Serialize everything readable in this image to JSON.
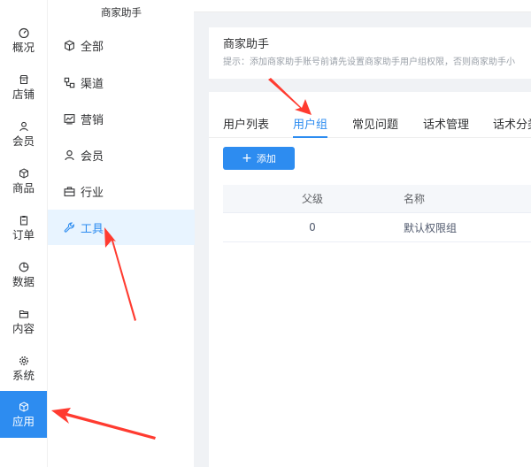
{
  "rail": {
    "items": [
      {
        "label": "概况",
        "icon": "dashboard-icon"
      },
      {
        "label": "店铺",
        "icon": "store-icon"
      },
      {
        "label": "会员",
        "icon": "user-icon"
      },
      {
        "label": "商品",
        "icon": "box-icon"
      },
      {
        "label": "订单",
        "icon": "clipboard-icon"
      },
      {
        "label": "数据",
        "icon": "pie-chart-icon"
      },
      {
        "label": "内容",
        "icon": "folder-icon"
      },
      {
        "label": "系统",
        "icon": "gear-icon"
      },
      {
        "label": "应用",
        "icon": "cube-icon"
      }
    ],
    "active": "应用"
  },
  "submenu": {
    "title": "商家助手",
    "items": [
      {
        "label": "全部",
        "icon": "cube-icon"
      },
      {
        "label": "渠道",
        "icon": "channel-icon"
      },
      {
        "label": "营销",
        "icon": "trend-chart-icon"
      },
      {
        "label": "会员",
        "icon": "user-icon"
      },
      {
        "label": "行业",
        "icon": "briefcase-icon"
      },
      {
        "label": "工具",
        "icon": "wrench-icon"
      }
    ],
    "active": "工具"
  },
  "header": {
    "title": "商家助手",
    "tip": "提示：添加商家助手账号前请先设置商家助手用户组权限，否则商家助手小"
  },
  "tabs": [
    {
      "label": "用户列表"
    },
    {
      "label": "用户组"
    },
    {
      "label": "常见问题"
    },
    {
      "label": "话术管理"
    },
    {
      "label": "话术分类"
    }
  ],
  "active_tab": "用户组",
  "add_button": {
    "label": "添加",
    "icon": "plus-icon"
  },
  "table": {
    "columns": [
      "父级",
      "名称"
    ],
    "rows": [
      [
        "0",
        "默认权限组"
      ]
    ]
  },
  "colors": {
    "primary": "#2d8cf0",
    "annotation_arrow": "#ff3b30"
  }
}
